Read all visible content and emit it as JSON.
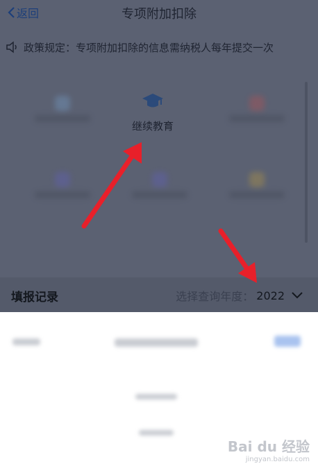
{
  "nav": {
    "back_label": "返回",
    "title": "专项附加扣除"
  },
  "notice": {
    "text": "政策规定：专项附加扣除的信息需纳税人每年提交一次"
  },
  "grid": {
    "featured_label": "继续教育"
  },
  "record": {
    "title": "填报记录",
    "year_label": "选择查询年度：",
    "year_value": "2022"
  },
  "watermark": {
    "brand": "Bai du 经验",
    "url": "jingyan.baidu.com"
  },
  "colors": {
    "overlay": "#5b6172",
    "arrow": "#e8202a",
    "accent": "#1d3f7a"
  },
  "icons": {
    "back": "chevron-left-icon",
    "speaker": "speaker-icon",
    "education": "graduation-cap-icon",
    "dropdown": "chevron-down-icon"
  }
}
